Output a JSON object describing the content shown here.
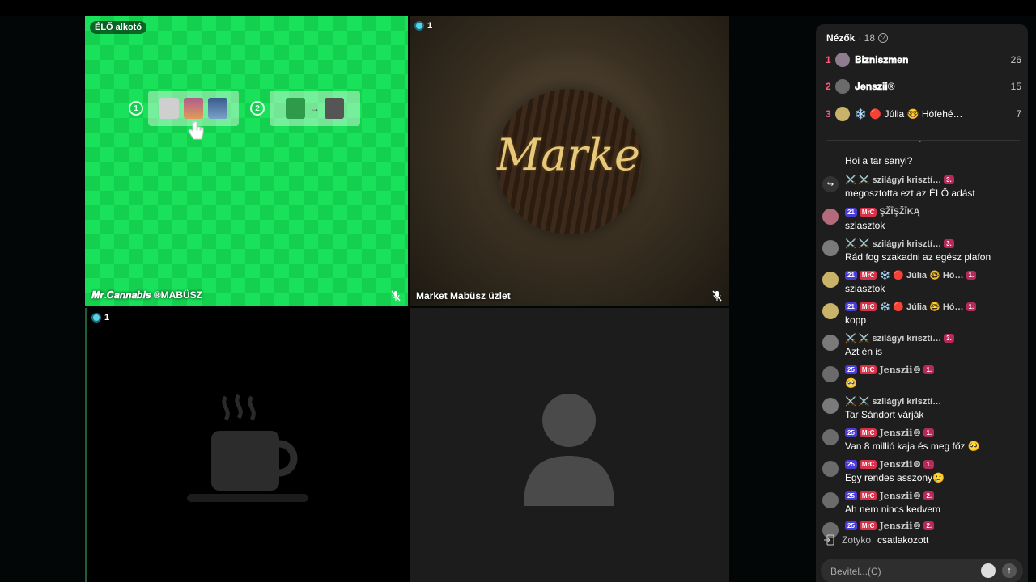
{
  "tiles": {
    "t1": {
      "badge": "ÉLŐ alkotó",
      "name": "𝑴𝒓.𝑪𝒂𝒏𝒏𝒂𝒃𝒊𝒔 ®MABÜSZ",
      "step1": "1",
      "step2": "2"
    },
    "t2": {
      "viewers": "1",
      "name": "Market Mabüsz üzlet",
      "logo": "Market"
    },
    "t3": {
      "viewers": "1"
    }
  },
  "panel": {
    "title": "Nézők",
    "count": "· 18",
    "ranks": [
      {
        "num": "1",
        "name": "𝐁𝐢𝐳𝐧𝐢𝐬𝐳𝐦𝐞𝐧",
        "score": "26"
      },
      {
        "num": "2",
        "name": "𝐉𝐞𝐧𝐬𝐳𝐢𝐢®",
        "score": "15"
      },
      {
        "num": "3",
        "name": "❄️ 🔴 Júlia 🤓 Hófehé…",
        "score": "7"
      }
    ],
    "messages": [
      {
        "user": "",
        "text": "Hoi a tar sanyi?",
        "pills": []
      },
      {
        "user": "⚔️ ⚔️ szilágyi krisztí…",
        "text": "megosztotta ezt az ÉLŐ adást",
        "pills": [
          "3."
        ]
      },
      {
        "user": "ŞŽĪŞŽĪKĄ",
        "text": "szlasztok",
        "pills": [
          "21",
          "MrC"
        ]
      },
      {
        "user": "⚔️ ⚔️ szilágyi krisztí…",
        "text": "Rád fog szakadni az egész plafon",
        "pills": [
          "3."
        ]
      },
      {
        "user": "❄️ 🔴 Júlia 🤓 Hó…",
        "text": "sziasztok",
        "pills": [
          "21",
          "MrC",
          "1."
        ]
      },
      {
        "user": "❄️ 🔴 Júlia 🤓 Hó…",
        "text": "kopp",
        "pills": [
          "21",
          "MrC",
          "1."
        ]
      },
      {
        "user": "⚔️ ⚔️ szilágyi krisztí…",
        "text": "Azt én is",
        "pills": [
          "3."
        ]
      },
      {
        "user": "Jenszii®",
        "text": "🥺",
        "pills": [
          "25",
          "MrC",
          "1."
        ]
      },
      {
        "user": "⚔️ ⚔️ szilágyi krisztí…",
        "text": "Tar Sándort várják",
        "pills": []
      },
      {
        "user": "Jenszii®",
        "text": "Van 8 millió kaja és meg főz 🥺",
        "pills": [
          "25",
          "MrC",
          "1."
        ]
      },
      {
        "user": "Jenszii®",
        "text": "Egy rendes asszony🥲",
        "pills": [
          "25",
          "MrC",
          "1."
        ]
      },
      {
        "user": "Jenszii®",
        "text": "Ah nem nincs kedvem",
        "pills": [
          "25",
          "MrC",
          "2."
        ]
      },
      {
        "user": "Jenszii®",
        "text": "",
        "pills": [
          "25",
          "MrC",
          "2."
        ]
      }
    ],
    "join": {
      "user": "Zotyko",
      "text": "csatlakozott"
    },
    "input_placeholder": "Bevitel...(C)"
  },
  "colors": {
    "green_screen": "#19e25a",
    "accent_pink": "#ff5a7a",
    "panel_bg": "#1e1e1e"
  }
}
